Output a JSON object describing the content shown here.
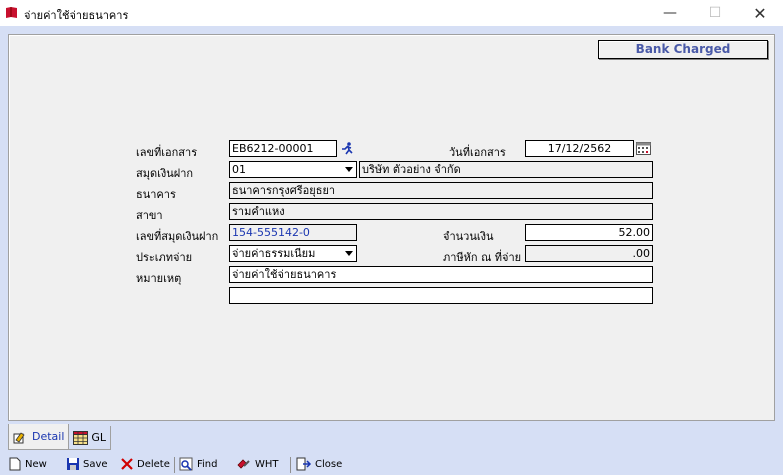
{
  "window": {
    "title": "จ่ายค่าใช้จ่ายธนาคาร",
    "minimize": "—",
    "maximize": "☐",
    "close": "✕"
  },
  "header": {
    "badge": "Bank Charged"
  },
  "form": {
    "doc_no_label": "เลขที่เอกสาร",
    "doc_no_value": "EB6212-00001",
    "doc_date_label": "วันที่เอกสาร",
    "doc_date_value": "17/12/2562",
    "passbook_label": "สมุดเงินฝาก",
    "passbook_value": "01",
    "company_value": "บริษัท ตัวอย่าง จำกัด",
    "bank_label": "ธนาคาร",
    "bank_value": "ธนาคารกรุงศรีอยุธยา",
    "branch_label": "สาขา",
    "branch_value": "รามคำแหง",
    "account_no_label": "เลขที่สมุดเงินฝาก",
    "account_no_value": "154-555142-0",
    "amount_label": "จำนวนเงิน",
    "amount_value": "52.00",
    "pay_type_label": "ประเภทจ่าย",
    "pay_type_value": "จ่ายค่าธรรมเนียม",
    "wht_label": "ภาษีหัก ณ ที่จ่าย",
    "wht_value": ".00",
    "remark_label": "หมายเหตุ",
    "remark_line1": "จ่ายค่าใช้จ่ายธนาคาร",
    "remark_line2": ""
  },
  "tabs": [
    {
      "label": "Detail",
      "icon": "detail-icon"
    },
    {
      "label": "GL",
      "icon": "grid-icon"
    }
  ],
  "toolbar": {
    "new": "New",
    "save": "Save",
    "delete": "Delete",
    "find": "Find",
    "wht": "WHT",
    "close": "Close"
  }
}
